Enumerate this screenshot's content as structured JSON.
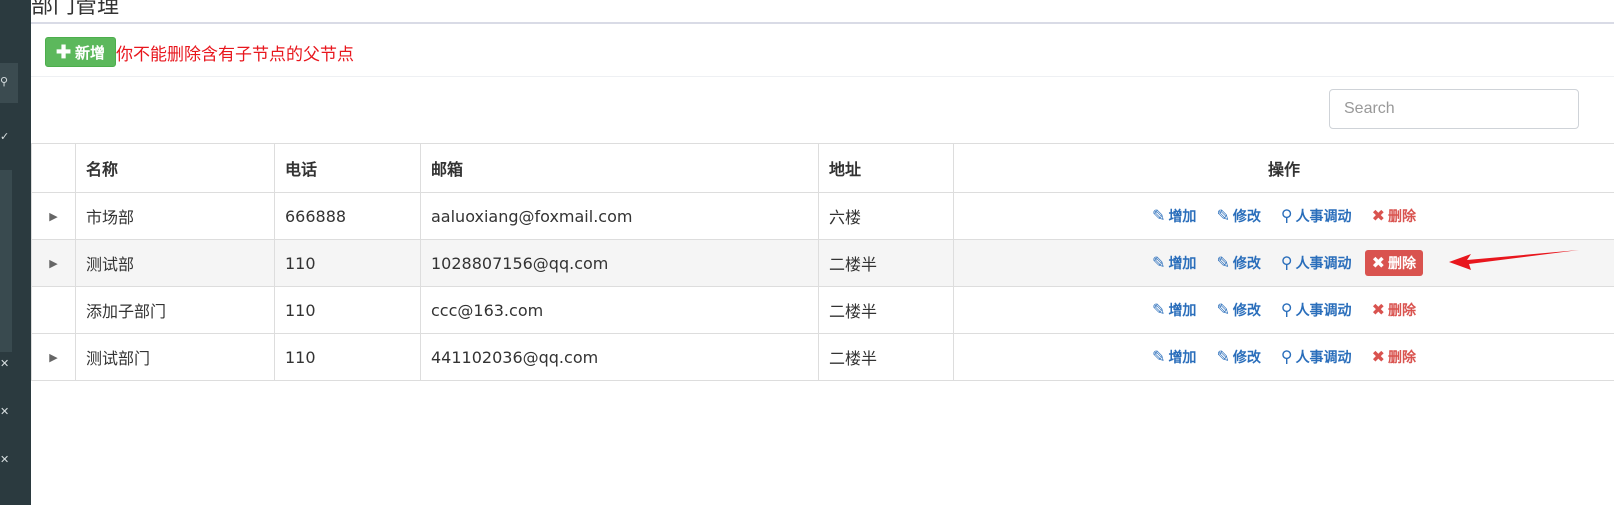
{
  "header": {
    "title_fragment": "部门管理"
  },
  "toolbar": {
    "add_label": "新增",
    "warning": "你不能删除含有子节点的父节点"
  },
  "search": {
    "placeholder": "Search"
  },
  "table": {
    "columns": [
      "名称",
      "电话",
      "邮箱",
      "地址",
      "操作"
    ],
    "rows": [
      {
        "name": "市场部",
        "phone": "666888",
        "email": "aaluoxiang@foxmail.com",
        "address": "六楼",
        "expandable": true
      },
      {
        "name": "测试部",
        "phone": "110",
        "email": "1028807156@qq.com",
        "address": "二楼半",
        "expandable": true
      },
      {
        "name": "添加子部门",
        "phone": "110",
        "email": "ccc@163.com",
        "address": "二楼半",
        "expandable": false
      },
      {
        "name": "测试部门",
        "phone": "110",
        "email": "441102036@qq.com",
        "address": "二楼半",
        "expandable": true
      }
    ],
    "actions": {
      "add": "增加",
      "edit": "修改",
      "transfer": "人事调动",
      "delete": "删除"
    }
  },
  "icons": {
    "expand": "triangle-right-icon",
    "add": "edit-icon",
    "edit": "edit-icon",
    "transfer": "search-icon",
    "delete": "close-icon"
  },
  "colors": {
    "sidebar": "#2b3a3f",
    "success": "#5cb85c",
    "danger": "#d9534f",
    "link": "#2a6ebb",
    "warning_text": "#e8161d"
  }
}
